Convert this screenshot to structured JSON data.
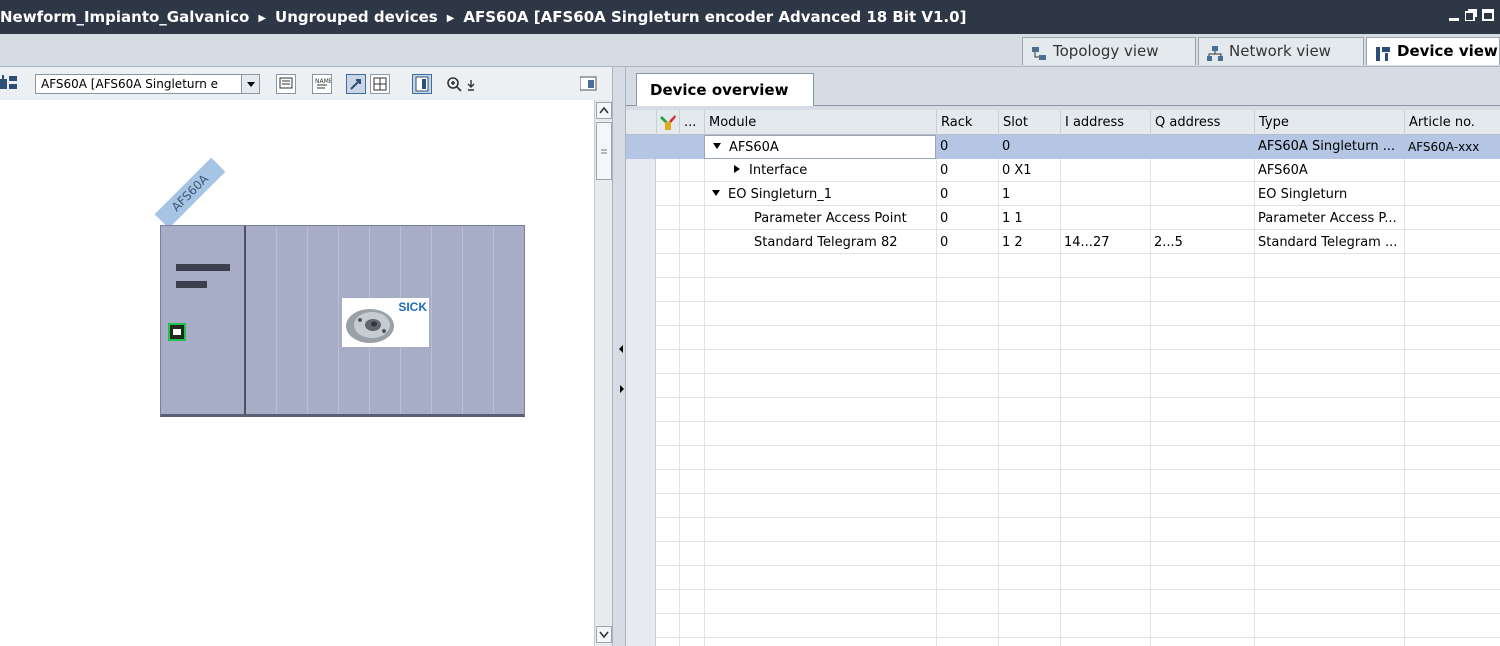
{
  "titlebar": {
    "crumbs": [
      "Newform_Impianto_Galvanico",
      "Ungrouped devices",
      "AFS60A [AFS60A Singleturn encoder Advanced 18 Bit V1.0]"
    ]
  },
  "views": {
    "topology": "Topology view",
    "network": "Network view",
    "device": "Device view"
  },
  "left": {
    "device_select": "AFS60A [AFS60A Singleturn e",
    "device_label": "AFS60A",
    "logo_text": "SICK"
  },
  "overview": {
    "tab": "Device overview",
    "columns": {
      "dots": "...",
      "module": "Module",
      "rack": "Rack",
      "slot": "Slot",
      "iaddr": "I address",
      "qaddr": "Q address",
      "type": "Type",
      "article": "Article no."
    },
    "rows": [
      {
        "module": "AFS60A",
        "rack": "0",
        "slot": "0",
        "iaddr": "",
        "qaddr": "",
        "type": "AFS60A Singleturn ...",
        "article": "AFS60A-xxx"
      },
      {
        "module": "Interface",
        "rack": "0",
        "slot": "0 X1",
        "iaddr": "",
        "qaddr": "",
        "type": "AFS60A",
        "article": ""
      },
      {
        "module": "EO Singleturn_1",
        "rack": "0",
        "slot": "1",
        "iaddr": "",
        "qaddr": "",
        "type": "EO Singleturn",
        "article": ""
      },
      {
        "module": "Parameter Access Point",
        "rack": "0",
        "slot": "1 1",
        "iaddr": "",
        "qaddr": "",
        "type": "Parameter Access P...",
        "article": ""
      },
      {
        "module": "Standard Telegram 82",
        "rack": "0",
        "slot": "1 2",
        "iaddr": "14...27",
        "qaddr": "2...5",
        "type": "Standard Telegram ...",
        "article": ""
      }
    ]
  },
  "colors": {
    "titlebar": "#2e3745",
    "device_body": "#a7acc7",
    "selection": "#b4c6e4",
    "port_green": "#22c24a"
  }
}
